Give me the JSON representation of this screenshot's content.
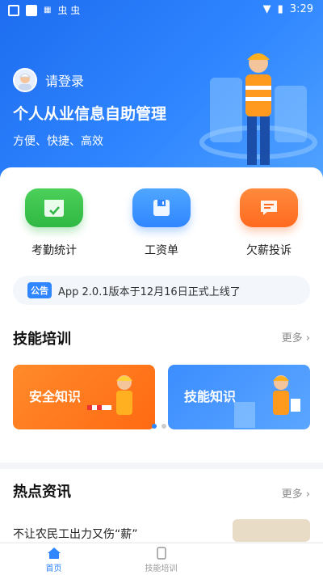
{
  "status_bar": {
    "time": "3:29"
  },
  "header": {
    "login_text": "请登录",
    "title": "个人从业信息自助管理",
    "subtitle": "方便、快捷、高效"
  },
  "quick_actions": [
    {
      "label": "考勤统计",
      "icon": "calendar-check-icon",
      "color": "#2fb843"
    },
    {
      "label": "工资单",
      "icon": "wallet-icon",
      "color": "#2f86ff"
    },
    {
      "label": "欠薪投诉",
      "icon": "complaint-icon",
      "color": "#ff6a1f"
    }
  ],
  "notice": {
    "tag": "公告",
    "text": "App 2.0.1版本于12月16日正式上线了"
  },
  "skills": {
    "title": "技能培训",
    "more": "更多",
    "banners": [
      {
        "label": "安全知识",
        "color": "#ff7a1a"
      },
      {
        "label": "技能知识",
        "color": "#3c8dff"
      }
    ]
  },
  "news": {
    "title": "热点资讯",
    "more": "更多",
    "items": [
      {
        "title": "不让农民工出力又伤“薪”"
      }
    ]
  },
  "tabbar": [
    {
      "label": "首页",
      "icon": "home-icon",
      "active": true
    },
    {
      "label": "技能培训",
      "icon": "book-icon",
      "active": false
    }
  ]
}
